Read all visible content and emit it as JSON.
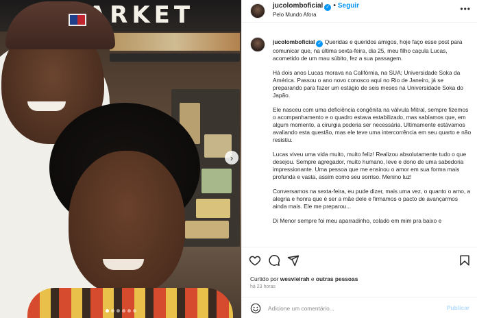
{
  "photo": {
    "store_sign": "MARKET",
    "carousel_dots": 6,
    "active_dot": 0,
    "next_icon": "chevron-right-icon"
  },
  "header": {
    "username": "jucolomboficial",
    "follow_label": "Seguir",
    "location": "Pelo Mundo Afora",
    "more_icon": "more-icon"
  },
  "caption": {
    "username": "jucolomboficial",
    "paragraphs": [
      "Queridas e queridos amigos, hoje faço esse post para comunicar que, na última sexta-feira, dia 25, meu filho caçula Lucas, acometido de um mau súbito, fez a sua passagem.",
      "Há dois anos Lucas morava na Califórnia, na SUA; Universidade Soka da América. Passou o ano novo conosco aqui no Rio de Janeiro, já se preparando para fazer um estágio de seis meses na Universidade Soka do Japão.",
      "Ele nasceu com uma deficiência congênita na válvula Mitral, sempre fizemos o acompanhamento e o quadro estava estabilizado, mas sabíamos que, em algum momento, a cirurgia poderia ser necessária. Ultimamente estávamos avaliando esta questão, mas ele teve uma intercorrência em seu quarto e não resistiu.",
      "Lucas viveu uma vida muito, muito feliz! Realizou absolutamente tudo o que desejou. Sempre agregador, muito humano, leve e dono de uma sabedoria impressionante. Uma pessoa que me ensinou o amor em sua forma mais profunda e vasta, assim como seu sorriso. Menino luz!",
      "Conversamos na sexta-feira, eu pude dizer, mais uma vez, o quanto o amo, a alegria e honra que é ser a mãe dele e firmamos o pacto de avançarmos ainda mais. Ele me preparou...",
      "Di Menor sempre foi meu aparradinho, colado em mim pra baixo e"
    ]
  },
  "actions": {
    "like_icon": "heart-icon",
    "comment_icon": "comment-icon",
    "share_icon": "share-icon",
    "save_icon": "bookmark-icon",
    "liked_by_prefix": "Curtido por ",
    "liked_by_user": "wesvieirah",
    "liked_by_suffix": " e ",
    "liked_by_others": "outras pessoas",
    "time": "há 23 horas"
  },
  "comment": {
    "emoji_icon": "emoji-icon",
    "placeholder": "Adicione um comentário...",
    "publish_label": "Publicar"
  },
  "colors": {
    "accent": "#0095f6",
    "publish_disabled": "#b3dbff",
    "text": "#262626",
    "muted": "#8e8e8e"
  }
}
